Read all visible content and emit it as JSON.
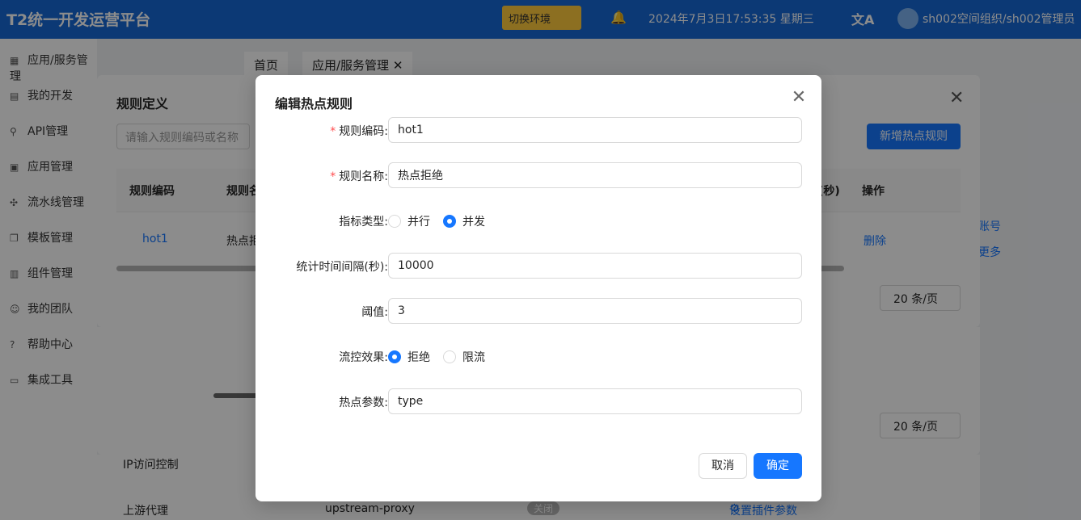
{
  "app": {
    "brand": "T2统一开发运营平台",
    "header_button": "切换环境",
    "datetime": "2024年7月3日17:53:35 星期三",
    "user": "sh002空间组织/sh002管理员"
  },
  "sidebar": {
    "items": [
      {
        "label": "应用/服务管理",
        "icon": "service-icon"
      },
      {
        "label": "我的开发",
        "icon": "dev-icon"
      },
      {
        "label": "API管理",
        "icon": "api-icon"
      },
      {
        "label": "应用管理",
        "icon": "app-icon"
      },
      {
        "label": "流水线管理",
        "icon": "pipeline-icon"
      },
      {
        "label": "模板管理",
        "icon": "template-icon"
      },
      {
        "label": "组件管理",
        "icon": "component-icon"
      },
      {
        "label": "我的团队",
        "icon": "team-icon"
      },
      {
        "label": "帮助中心",
        "icon": "help-icon"
      },
      {
        "label": "集成工具",
        "icon": "tools-icon"
      }
    ]
  },
  "tabs": [
    {
      "label": "首页"
    },
    {
      "label": "应用/服务管理"
    }
  ],
  "rule_modal": {
    "title": "规则定义",
    "search_placeholder": "请输入规则编码或名称",
    "add_button": "新增热点规则",
    "columns": [
      "规则编码",
      "规则名",
      "(秒)",
      "操作"
    ],
    "row": {
      "code": "hot1",
      "name": "热点拒",
      "action": "删除"
    },
    "page_size": "20 条/页"
  },
  "lower_panel": {
    "page_size": "20 条/页",
    "rows": [
      {
        "label": "IP访问控制"
      },
      {
        "label": "上游代理",
        "value": "upstream-proxy",
        "toggle": "关闭",
        "action": "设置插件参数"
      }
    ]
  },
  "side_links": [
    "账号",
    "更多"
  ],
  "edit_modal": {
    "title": "编辑热点规则",
    "fields": {
      "code": {
        "label": "规则编码:",
        "value": "hot1",
        "required": true
      },
      "name": {
        "label": "规则名称:",
        "value": "热点拒绝",
        "required": true
      },
      "metric_type": {
        "label": "指标类型:",
        "options": [
          "并行",
          "并发"
        ],
        "selected": "并发"
      },
      "interval": {
        "label": "统计时间间隔(秒):",
        "value": "10000"
      },
      "threshold": {
        "label": "阈值:",
        "value": "3"
      },
      "effect": {
        "label": "流控效果:",
        "options": [
          "拒绝",
          "限流"
        ],
        "selected": "拒绝"
      },
      "param": {
        "label": "热点参数:",
        "value": "type"
      }
    },
    "cancel_label": "取消",
    "ok_label": "确定"
  },
  "colors": {
    "primary": "#1677ff",
    "required": "#ff4d4f",
    "header": "#1668d6"
  }
}
